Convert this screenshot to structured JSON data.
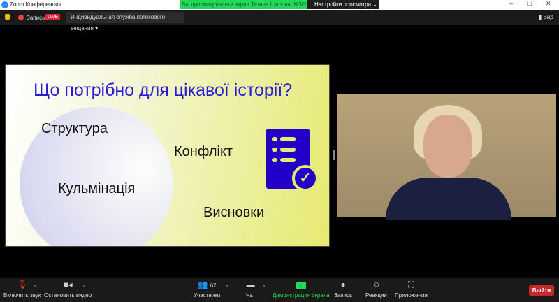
{
  "window": {
    "title": "Zoom Конференция",
    "minimize": "–",
    "maximize": "❐",
    "close": "✕"
  },
  "banner": {
    "text": "Вы просматриваете экран Тетяна Шарова ІМЗО",
    "view_options": "Настройки просмотра ⌄"
  },
  "topbar": {
    "record": "Запись",
    "live": "LIVE",
    "stream_service": "Индивидуальная служба потокового вещания ▾",
    "view": "Вид"
  },
  "slide": {
    "title": "Що потрібно для цікавої історії?",
    "items": [
      "Структура",
      "Конфлікт",
      "Кульмінація",
      "Висновки"
    ]
  },
  "toolbar": {
    "unmute": "Включить звук",
    "stop_video": "Остановить видео",
    "participants": "Участники",
    "participants_count": "62",
    "chat": "Чат",
    "share_screen": "Демонстрация экрана",
    "record": "Запись",
    "reactions": "Реакции",
    "apps": "Приложения",
    "leave": "Выйти"
  },
  "colors": {
    "accent_green": "#23d959",
    "live_red": "#e02a3a",
    "leave_red": "#c8282b",
    "slide_blue": "#2a1bd6"
  }
}
